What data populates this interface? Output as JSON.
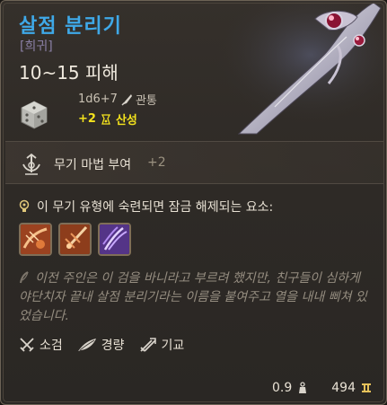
{
  "item": {
    "name": "살점 분리기",
    "rarity": "[희귀]",
    "damage": "10~15 피해",
    "damage_dice": "1d6+7",
    "damage_type": "관통",
    "stat_bonus": "+2",
    "stat_name": "산성",
    "name_color": "#3fa9e8",
    "bonus_color": "#f3e21d"
  },
  "enchant": {
    "label": "무기 마법 부여",
    "bonus": "+2",
    "icon": "enchant-weapon-icon"
  },
  "proficiency": {
    "title": "이 무기 유형에 숙련되면 잠금 해제되는 요소:",
    "skills": [
      {
        "icon": "skill-slash-icon"
      },
      {
        "icon": "skill-pierce-icon"
      },
      {
        "icon": "skill-claw-icon"
      }
    ]
  },
  "lore": "이전 주인은 이 검을 바니라고 부르려 했지만, 친구들이 심하게 야단치자 끝내 살점 분리기라는 이름을 붙여주고 열을 내내 삐쳐 있었습니다.",
  "properties": [
    {
      "label": "소검",
      "icon": "shortsword-icon"
    },
    {
      "label": "경량",
      "icon": "feather-icon"
    },
    {
      "label": "기교",
      "icon": "finesse-icon"
    }
  ],
  "footer": {
    "weight": "0.9",
    "weight_icon": "weight-icon",
    "value": "494",
    "value_icon": "gold-icon"
  }
}
